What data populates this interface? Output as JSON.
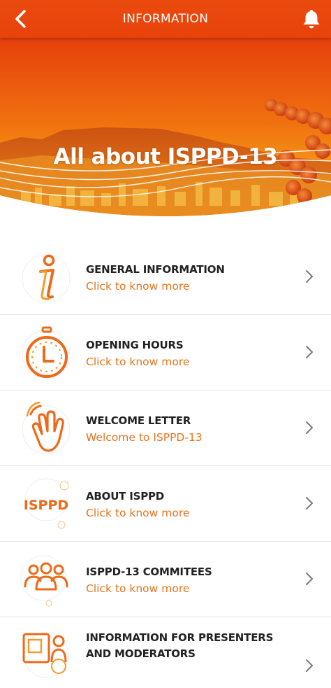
{
  "header": {
    "title": "INFORMATION",
    "back_icon": "back-chevron-icon",
    "bell_icon": "bell-icon",
    "background": "#e8430c"
  },
  "hero": {
    "title": "All about ISPPD-13"
  },
  "accent": "#e8741e",
  "items": [
    {
      "title": "GENERAL INFORMATION",
      "subtitle": "Click to know more",
      "icon": "info-icon"
    },
    {
      "title": "OPENING HOURS",
      "subtitle": "Click to know more",
      "icon": "stopwatch-icon"
    },
    {
      "title": "WELCOME LETTER",
      "subtitle": "Welcome to ISPPD-13",
      "icon": "waving-hand-icon"
    },
    {
      "title": "ABOUT ISPPD",
      "subtitle": "Click to know more",
      "icon": "isppd-logo-icon",
      "icon_text": "ISPPD"
    },
    {
      "title": "ISPPD-13 COMMITEES",
      "subtitle": "Click to know more",
      "icon": "group-people-icon"
    },
    {
      "title": "INFORMATION FOR PRESENTERS AND MODERATORS",
      "subtitle": "",
      "icon": "presenter-icon"
    }
  ]
}
